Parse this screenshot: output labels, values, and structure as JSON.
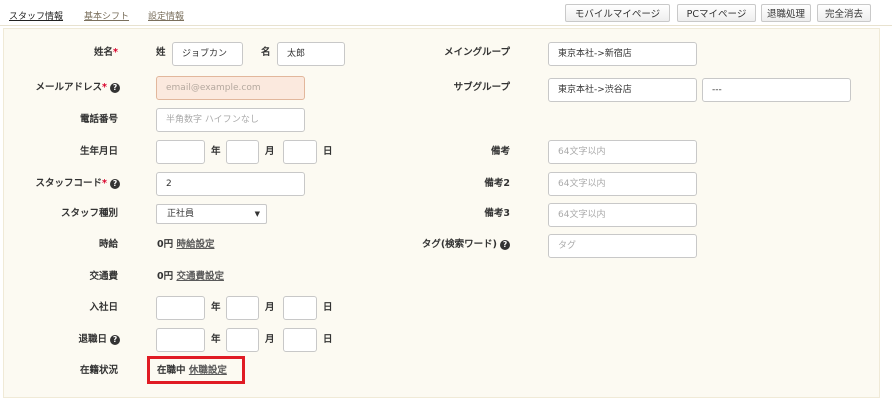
{
  "tabs": [
    "スタッフ情報",
    "基本シフト",
    "設定情報"
  ],
  "toolbar": {
    "mobile_mypage": "モバイルマイページ",
    "pc_mypage": "PCマイページ",
    "retire": "退職処理",
    "delete_all": "完全消去"
  },
  "labels": {
    "name": "姓名",
    "email": "メールアドレス",
    "phone": "電話番号",
    "birthdate": "生年月日",
    "staff_code": "スタッフコード",
    "staff_type": "スタッフ種別",
    "hourly_wage": "時給",
    "transport": "交通費",
    "join_date": "入社日",
    "retire_date": "退職日",
    "status": "在籍状況",
    "main_group": "メイングループ",
    "sub_group": "サブグループ",
    "note": "備考",
    "note2": "備考2",
    "note3": "備考3",
    "tag": "タグ(検索ワード)"
  },
  "required_mark": "*",
  "help_mark": "?",
  "name": {
    "last_label": "姓",
    "last_value": "ジョブカン",
    "first_label": "名",
    "first_value": "太郎"
  },
  "email": {
    "placeholder": "email@example.com"
  },
  "phone": {
    "placeholder": "半角数字 ハイフンなし"
  },
  "date_units": {
    "year": "年",
    "month": "月",
    "day": "日"
  },
  "staff_code": {
    "value": "2"
  },
  "staff_type": {
    "selected": "正社員"
  },
  "hourly_wage": {
    "value": "0円",
    "link": "時給設定"
  },
  "transport": {
    "value": "0円",
    "link": "交通費設定"
  },
  "status": {
    "value": "在職中",
    "link": "休職設定"
  },
  "main_group": {
    "value": "東京本社->新宿店"
  },
  "sub_group": {
    "value": "東京本社->渋谷店",
    "value2": "---"
  },
  "notes": {
    "placeholder": "64文字以内"
  },
  "tag": {
    "placeholder": "タグ"
  }
}
